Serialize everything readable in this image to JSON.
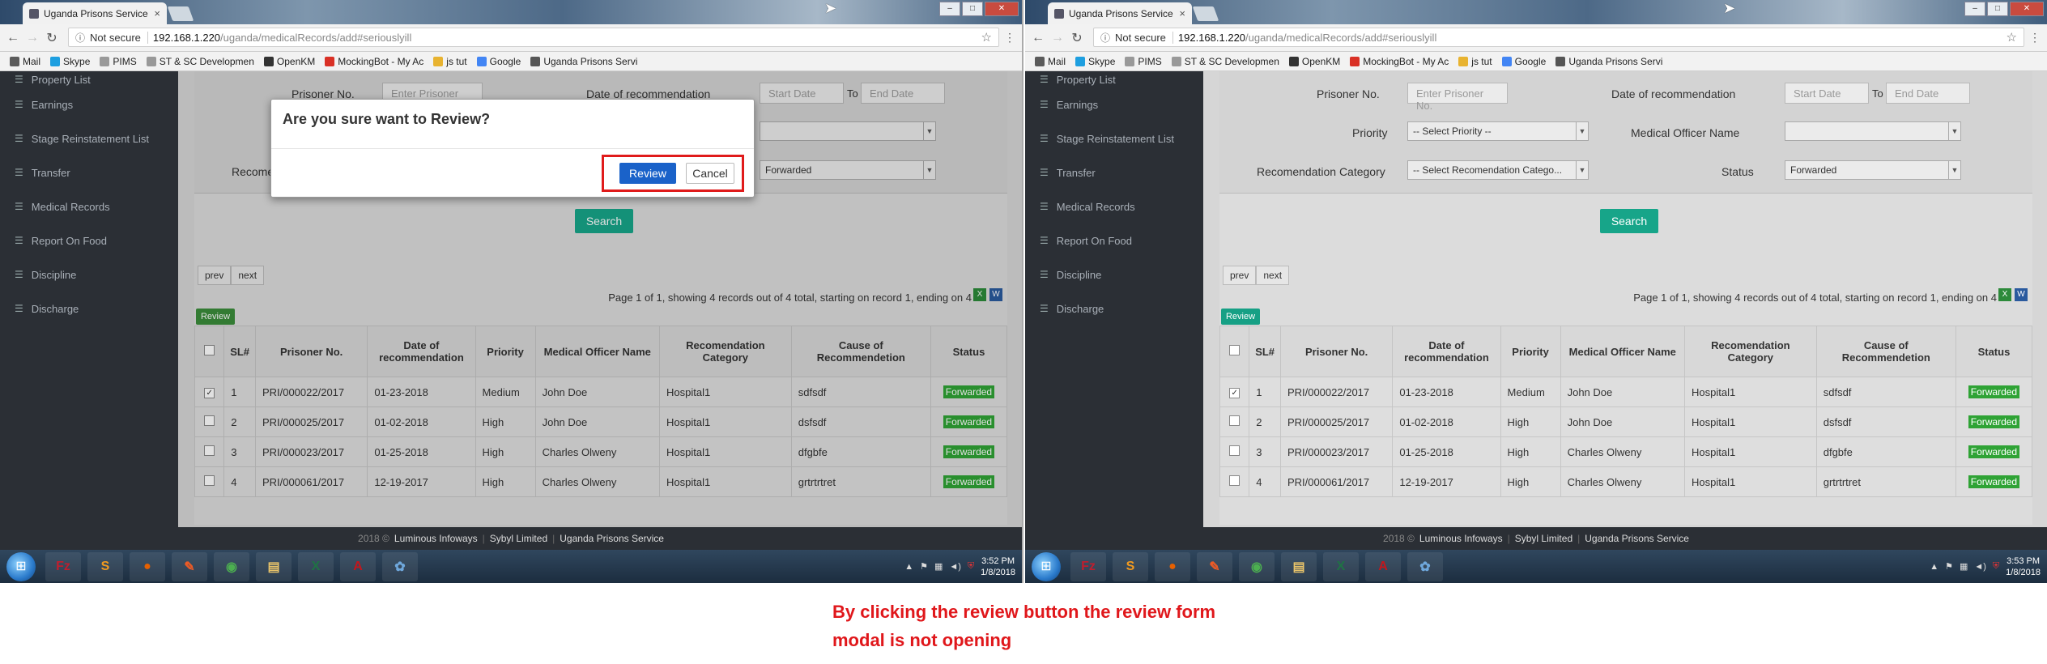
{
  "browser": {
    "tab_title": "Uganda Prisons Service",
    "not_secure": "Not secure",
    "url_host": "192.168.1.220",
    "url_path": "/uganda/medicalRecords/add#seriouslyill",
    "bookmarks": [
      {
        "label": "Mail",
        "icon": "mail-icon",
        "color": "#5b5b5b"
      },
      {
        "label": "Skype",
        "icon": "skype-icon",
        "color": "#1e9fe0"
      },
      {
        "label": "PIMS",
        "icon": "page-icon",
        "color": "#999999"
      },
      {
        "label": "ST & SC Developmen",
        "icon": "page-icon",
        "color": "#999999"
      },
      {
        "label": "OpenKM",
        "icon": "openkm-icon",
        "color": "#333333"
      },
      {
        "label": "MockingBot - My Ac",
        "icon": "mockingbot-icon",
        "color": "#d93025"
      },
      {
        "label": "js tut",
        "icon": "folder-icon",
        "color": "#e8b330"
      },
      {
        "label": "Google",
        "icon": "google-icon",
        "color": "#4285f4"
      },
      {
        "label": "Uganda Prisons Servi",
        "icon": "prisons-icon",
        "color": "#555555"
      }
    ]
  },
  "sidebar": {
    "items": [
      {
        "label": "Property List"
      },
      {
        "label": "Earnings"
      },
      {
        "label": "Stage Reinstatement List"
      },
      {
        "label": "Transfer"
      },
      {
        "label": "Medical Records"
      },
      {
        "label": "Report On Food"
      },
      {
        "label": "Discipline"
      },
      {
        "label": "Discharge"
      }
    ]
  },
  "filters": {
    "prisoner_no_label": "Prisoner No.",
    "prisoner_no_placeholder": "Enter Prisoner No.",
    "date_label": "Date of recommendation",
    "start_placeholder": "Start Date",
    "to_label": "To",
    "end_placeholder": "End Date",
    "priority_label": "Priority",
    "priority_value": "-- Select Priority --",
    "officer_label": "Medical Officer Name",
    "officer_value": "",
    "category_label": "Recomendation Category",
    "category_value": "-- Select Recomendation Catego...",
    "status_label": "Status",
    "status_value": "Forwarded",
    "search_button": "Search"
  },
  "pager": {
    "prev": "prev",
    "next": "next"
  },
  "page_info": "Page 1 of 1, showing 4 records out of 4 total, starting on record 1, ending on 4",
  "review_button_small": "Review",
  "table": {
    "headers": [
      "SL#",
      "Prisoner No.",
      "Date of recommendation",
      "Priority",
      "Medical Officer Name",
      "Recomendation Category",
      "Cause of Recommendetion",
      "Status"
    ],
    "rows": [
      {
        "checked": true,
        "sl": "1",
        "prisoner": "PRI/000022/2017",
        "date": "01-23-2018",
        "priority": "Medium",
        "officer": "John Doe",
        "category": "Hospital1",
        "cause": "sdfsdf",
        "status": "Forwarded"
      },
      {
        "checked": false,
        "sl": "2",
        "prisoner": "PRI/000025/2017",
        "date": "01-02-2018",
        "priority": "High",
        "officer": "John Doe",
        "category": "Hospital1",
        "cause": "dsfsdf",
        "status": "Forwarded"
      },
      {
        "checked": false,
        "sl": "3",
        "prisoner": "PRI/000023/2017",
        "date": "01-25-2018",
        "priority": "High",
        "officer": "Charles Olweny",
        "category": "Hospital1",
        "cause": "dfgbfe",
        "status": "Forwarded"
      },
      {
        "checked": false,
        "sl": "4",
        "prisoner": "PRI/000061/2017",
        "date": "12-19-2017",
        "priority": "High",
        "officer": "Charles Olweny",
        "category": "Hospital1",
        "cause": "grtrtrtret",
        "status": "Forwarded"
      }
    ]
  },
  "footer": {
    "year": "2018 ©",
    "company": "Luminous Infoways",
    "partner": "Sybyl Limited",
    "org": "Uganda Prisons Service"
  },
  "modal": {
    "title": "Are you sure want to Review?",
    "review": "Review",
    "cancel": "Cancel"
  },
  "taskbar": {
    "apps": [
      {
        "icon": "filezilla-icon",
        "glyph": "Fz",
        "color": "#bf1e2e"
      },
      {
        "icon": "sublime-icon",
        "glyph": "S",
        "color": "#f29a1f"
      },
      {
        "icon": "firefox-icon",
        "glyph": "●",
        "color": "#e66000"
      },
      {
        "icon": "postman-icon",
        "glyph": "✎",
        "color": "#ef5b25"
      },
      {
        "icon": "chrome-icon",
        "glyph": "◉",
        "color": "#4caf50"
      },
      {
        "icon": "explorer-icon",
        "glyph": "▤",
        "color": "#e9c46a"
      },
      {
        "icon": "excel-icon",
        "glyph": "X",
        "color": "#1f7244"
      },
      {
        "icon": "acrobat-icon",
        "glyph": "A",
        "color": "#c4161c"
      },
      {
        "icon": "paint-icon",
        "glyph": "✿",
        "color": "#6fa8dc"
      }
    ],
    "left_time": "3:52 PM",
    "right_time": "3:53 PM",
    "date": "1/8/2018"
  },
  "caption": {
    "line1": "By clicking the review button the review form",
    "line2": "modal is not opening"
  }
}
